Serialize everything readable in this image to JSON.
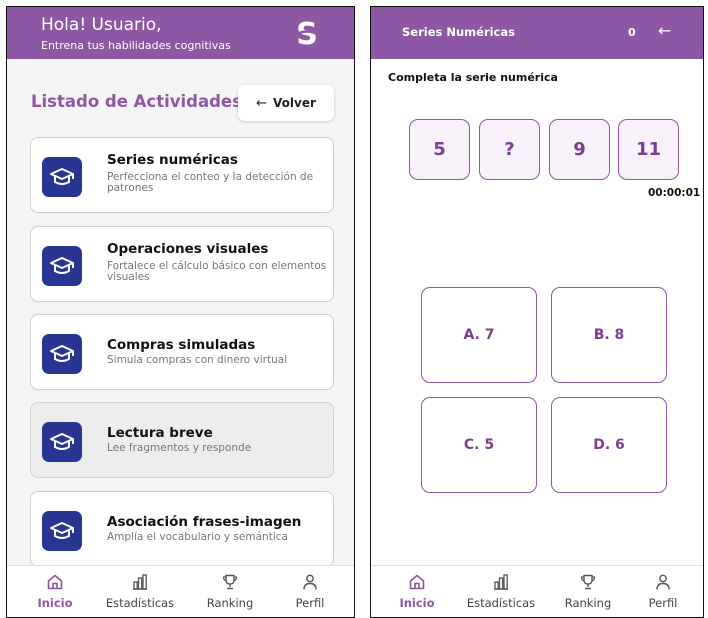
{
  "left": {
    "greeting": "Hola! Usuario,",
    "subtitle": "Entrena tus habilidades cognitivas",
    "logo_letter": "S",
    "list_title": "Listado de Actividades",
    "back_arrow": "←",
    "back_label": "Volver",
    "activities": [
      {
        "title": "Series numéricas",
        "desc": "Perfecciona el conteo y la detección de patrones",
        "icon": "graduation-cap-icon"
      },
      {
        "title": "Operaciones visuales",
        "desc": "Fortalece el cálculo básico con elementos visuales",
        "icon": "graduation-cap-icon"
      },
      {
        "title": "Compras simuladas",
        "desc": "Simula compras con dinero virtual",
        "icon": "graduation-cap-icon"
      },
      {
        "title": "Lectura breve",
        "desc": "Lee fragmentos y responde",
        "icon": "graduation-cap-icon"
      },
      {
        "title": "Asociación frases-imagen",
        "desc": "Amplía el vocabulario y semántica",
        "icon": "graduation-cap-icon"
      }
    ]
  },
  "right": {
    "title": "Series Numéricas",
    "score": "0",
    "back_arrow": "←",
    "instruction": "Completa la serie numérica",
    "sequence": [
      "5",
      "?",
      "9",
      "11"
    ],
    "timer": "00:00:01",
    "options": [
      "A. 7",
      "B. 8",
      "C. 5",
      "D. 6"
    ]
  },
  "nav": {
    "items": [
      {
        "label": "Inicio",
        "icon": "home-icon",
        "active": true
      },
      {
        "label": "Estadísticas",
        "icon": "bar-chart-icon",
        "active": false
      },
      {
        "label": "Ranking",
        "icon": "trophy-icon",
        "active": false
      },
      {
        "label": "Perfil",
        "icon": "user-icon",
        "active": false
      }
    ]
  },
  "colors": {
    "primary_purple": "#8e57a3",
    "icon_blue": "#283593"
  }
}
